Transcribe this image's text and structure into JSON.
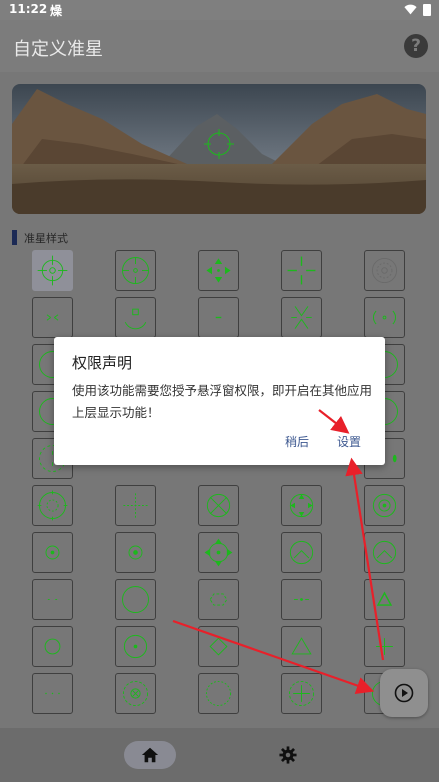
{
  "status_bar": {
    "time": "11:22",
    "indicator": "燥"
  },
  "app_bar": {
    "title": "自定义准星",
    "help_label": "?"
  },
  "section": {
    "label": "准星样式"
  },
  "dialog": {
    "title": "权限声明",
    "message": "使用该功能需要您授予悬浮窗权限，即开启在其他应用上层显示功能！",
    "cancel_label": "稍后",
    "confirm_label": "设置"
  },
  "colors": {
    "crosshair_green": "#1db81d",
    "dialog_button": "#3d5890",
    "annotation_arrow": "#e8202a"
  },
  "icons": {
    "help": "help-circle-icon",
    "home": "home-icon",
    "settings": "gear-icon",
    "fab": "play-circle-icon"
  }
}
